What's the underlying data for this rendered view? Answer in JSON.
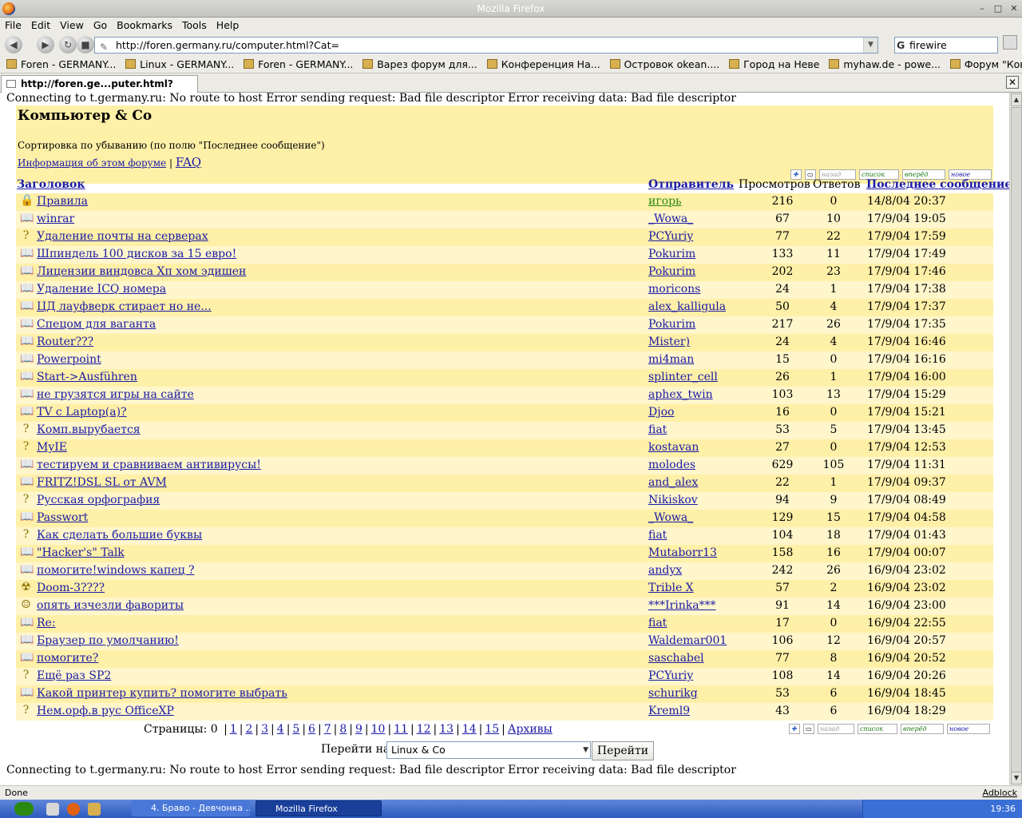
{
  "window": {
    "title": "Mozilla Firefox"
  },
  "menu": [
    "File",
    "Edit",
    "View",
    "Go",
    "Bookmarks",
    "Tools",
    "Help"
  ],
  "navbar": {
    "url": "http://foren.germany.ru/computer.html?Cat=",
    "search": "firewire"
  },
  "bookmarks": [
    "Foren - GERMANY...",
    "Linux - GERMANY...",
    "Foren - GERMANY...",
    "Варез форум для...",
    "Конференция На...",
    "Островок okean....",
    "Город на Неве",
    "myhaw.de - powe...",
    "Форум \"Ковчег У..."
  ],
  "tab": {
    "label": "http://foren.ge...puter.html?Cat="
  },
  "page": {
    "error_top": "Connecting to t.germany.ru: No route to host Error sending request: Bad file descriptor Error receiving data: Bad file descriptor",
    "error_bottom": "Connecting to t.germany.ru: No route to host Error sending request: Bad file descriptor Error receiving data: Bad file descriptor",
    "forum_title": "Компьютер & Co",
    "sort_text": "Сортировка по убыванию (по полю \"Последнее сообщение\")",
    "info_link": "Информация об этом форуме",
    "faq_link": "FAQ",
    "nav_icons": [
      "назад",
      "список",
      "вперёд",
      "новое"
    ],
    "columns": {
      "title": "Заголовок",
      "author": "Отправитель",
      "views": "Просмотров",
      "replies": "Ответов",
      "last": "Последнее сообщение"
    },
    "threads": [
      {
        "icon": "lock",
        "title": "Правила",
        "author": "игорь",
        "views": "216",
        "replies": "0",
        "last": "14/8/04 20:37",
        "author_green": true
      },
      {
        "icon": "book",
        "title": "winrar",
        "author": "_Wowa_",
        "views": "67",
        "replies": "10",
        "last": "17/9/04 19:05"
      },
      {
        "icon": "question",
        "title": "Удаление почты на серверах",
        "author": "PCYuriy",
        "views": "77",
        "replies": "22",
        "last": "17/9/04 17:59"
      },
      {
        "icon": "book",
        "title": "Шпиндель 100 дисков за 15 евро!",
        "author": "Pokurim",
        "views": "133",
        "replies": "11",
        "last": "17/9/04 17:49"
      },
      {
        "icon": "book",
        "title": "Лицензии виндовса Хп хом эдишен",
        "author": "Pokurim",
        "views": "202",
        "replies": "23",
        "last": "17/9/04 17:46"
      },
      {
        "icon": "book",
        "title": "Удаление ICQ номера",
        "author": "moricons",
        "views": "24",
        "replies": "1",
        "last": "17/9/04 17:38"
      },
      {
        "icon": "book",
        "title": "ЦД лауфверк стирает но не...",
        "author": "alex_kalligula",
        "views": "50",
        "replies": "4",
        "last": "17/9/04 17:37"
      },
      {
        "icon": "book",
        "title": "Спецом для ваганта",
        "author": "Pokurim",
        "views": "217",
        "replies": "26",
        "last": "17/9/04 17:35"
      },
      {
        "icon": "book",
        "title": "Router???",
        "author": "Mister)",
        "views": "24",
        "replies": "4",
        "last": "17/9/04 16:46"
      },
      {
        "icon": "book",
        "title": "Powerpoint",
        "author": "mi4man",
        "views": "15",
        "replies": "0",
        "last": "17/9/04 16:16"
      },
      {
        "icon": "book",
        "title": "Start->Ausführen",
        "author": "splinter_cell",
        "views": "26",
        "replies": "1",
        "last": "17/9/04 16:00"
      },
      {
        "icon": "book",
        "title": "не грузятся игры на сайте",
        "author": "aphex_twin",
        "views": "103",
        "replies": "13",
        "last": "17/9/04 15:29"
      },
      {
        "icon": "book",
        "title": "TV c Laptop(a)?",
        "author": "Djoo",
        "views": "16",
        "replies": "0",
        "last": "17/9/04 15:21"
      },
      {
        "icon": "question",
        "title": "Комп.вырубается",
        "author": "fiat",
        "views": "53",
        "replies": "5",
        "last": "17/9/04 13:45"
      },
      {
        "icon": "question",
        "title": "MyIE",
        "author": "kostavan",
        "views": "27",
        "replies": "0",
        "last": "17/9/04 12:53"
      },
      {
        "icon": "book",
        "title": "тестируем и сравниваем антивирусы!",
        "author": "molodes",
        "views": "629",
        "replies": "105",
        "last": "17/9/04 11:31"
      },
      {
        "icon": "book",
        "title": "FRITZ!DSL SL от AVM",
        "author": "and_alex",
        "views": "22",
        "replies": "1",
        "last": "17/9/04 09:37"
      },
      {
        "icon": "question",
        "title": "Русская орфография",
        "author": "Nikiskov",
        "views": "94",
        "replies": "9",
        "last": "17/9/04 08:49"
      },
      {
        "icon": "book",
        "title": "Passwort",
        "author": "_Wowa_",
        "views": "129",
        "replies": "15",
        "last": "17/9/04 04:58"
      },
      {
        "icon": "question",
        "title": "Как сделать большие буквы",
        "author": "fiat",
        "views": "104",
        "replies": "18",
        "last": "17/9/04 01:43"
      },
      {
        "icon": "book",
        "title": "\"Hacker's\" Talk",
        "author": "Mutaborr13",
        "views": "158",
        "replies": "16",
        "last": "17/9/04 00:07"
      },
      {
        "icon": "book",
        "title": "помогите!windows капец ?",
        "author": "andyx",
        "views": "242",
        "replies": "26",
        "last": "16/9/04 23:02"
      },
      {
        "icon": "radiation",
        "title": "Doom-3????",
        "author": "Trible X",
        "views": "57",
        "replies": "2",
        "last": "16/9/04 23:02"
      },
      {
        "icon": "smiley",
        "title": "опять изчезли фавориты",
        "author": "***Irinka***",
        "views": "91",
        "replies": "14",
        "last": "16/9/04 23:00"
      },
      {
        "icon": "book",
        "title": "Re:",
        "author": "fiat",
        "views": "17",
        "replies": "0",
        "last": "16/9/04 22:55"
      },
      {
        "icon": "book",
        "title": "Браузер по умолчанию!",
        "author": "Waldemar001",
        "views": "106",
        "replies": "12",
        "last": "16/9/04 20:57"
      },
      {
        "icon": "book",
        "title": "помогите?",
        "author": "saschabel",
        "views": "77",
        "replies": "8",
        "last": "16/9/04 20:52"
      },
      {
        "icon": "question",
        "title": "Ещё раз SP2",
        "author": "PCYuriy",
        "views": "108",
        "replies": "14",
        "last": "16/9/04 20:26"
      },
      {
        "icon": "book",
        "title": "Какой принтер купить? помогите выбрать",
        "author": "schurikg",
        "views": "53",
        "replies": "6",
        "last": "16/9/04 18:45"
      },
      {
        "icon": "question",
        "title": "Нем.орф.в рус OfficeXP",
        "author": "Kreml9",
        "views": "43",
        "replies": "6",
        "last": "16/9/04 18:29"
      }
    ],
    "pager": {
      "label": "Страницы:",
      "current": "0",
      "pages": [
        "1",
        "2",
        "3",
        "4",
        "5",
        "6",
        "7",
        "8",
        "9",
        "10",
        "11",
        "12",
        "13",
        "14",
        "15"
      ],
      "archive": "Архивы"
    },
    "goto": {
      "label": "Перейти на",
      "selected": "Linux & Co",
      "button": "Перейти"
    }
  },
  "status": {
    "text": "Done",
    "adblock": "Adblock"
  },
  "taskbar": {
    "items": [
      "4. Браво - Девчонка ...",
      "Mozilla Firefox"
    ],
    "clock": "19:36"
  }
}
